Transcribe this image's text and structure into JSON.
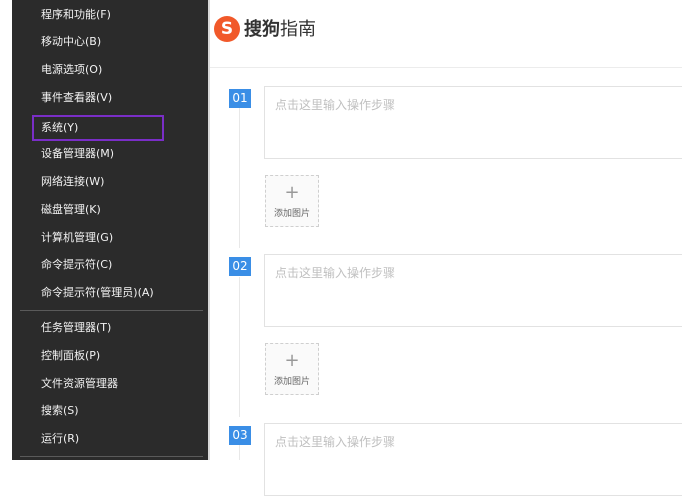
{
  "context_menu": {
    "items": [
      {
        "label": "程序和功能(F)"
      },
      {
        "label": "移动中心(B)"
      },
      {
        "label": "电源选项(O)"
      },
      {
        "label": "事件查看器(V)"
      },
      {
        "label": "系统(Y)",
        "highlighted": true
      },
      {
        "label": "设备管理器(M)"
      },
      {
        "label": "网络连接(W)"
      },
      {
        "label": "磁盘管理(K)"
      },
      {
        "label": "计算机管理(G)"
      },
      {
        "label": "命令提示符(C)"
      },
      {
        "label": "命令提示符(管理员)(A)"
      },
      {
        "label": "任务管理器(T)"
      },
      {
        "label": "控制面板(P)"
      },
      {
        "label": "文件资源管理器"
      },
      {
        "label": "搜索(S)"
      },
      {
        "label": "运行(R)"
      }
    ],
    "highlight_color": "#7a2ec7"
  },
  "header": {
    "logo_letter": "S",
    "brand_main": "搜狗",
    "brand_sub": "指南"
  },
  "steps": [
    {
      "number": "01",
      "placeholder": "点击这里输入操作步骤",
      "add_image_label": "添加图片",
      "add_icon": "+"
    },
    {
      "number": "02",
      "placeholder": "点击这里输入操作步骤",
      "add_image_label": "添加图片",
      "add_icon": "+"
    },
    {
      "number": "03",
      "placeholder": "点击这里输入操作步骤"
    }
  ],
  "colors": {
    "accent": "#3a8ee6",
    "brand": "#f1592a"
  }
}
